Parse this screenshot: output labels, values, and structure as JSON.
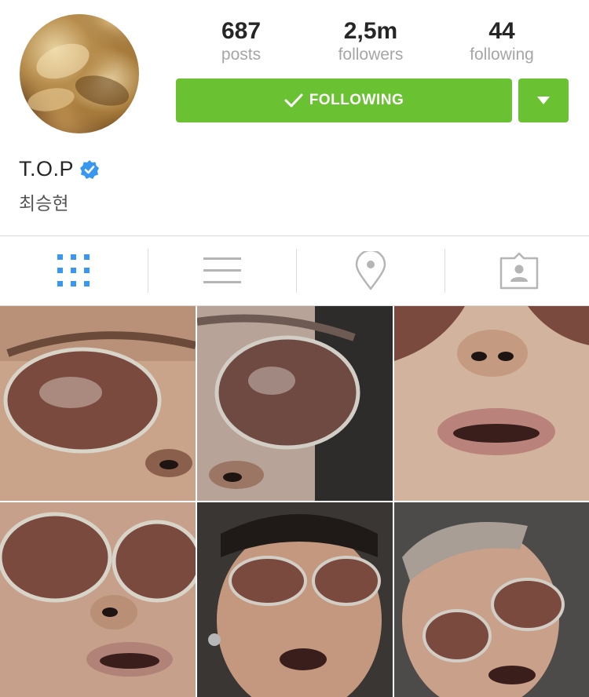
{
  "profile": {
    "username": "T.O.P",
    "full_name": "최승현",
    "verified": true
  },
  "stats": {
    "posts": {
      "value": "687",
      "label": "posts"
    },
    "followers": {
      "value": "2,5m",
      "label": "followers"
    },
    "following": {
      "value": "44",
      "label": "following"
    }
  },
  "actions": {
    "follow_label": "FOLLOWING",
    "follow_icon": "checkmark-icon",
    "dropdown_icon": "caret-down-icon"
  },
  "tabs": [
    {
      "icon": "grid-view-icon",
      "active": true
    },
    {
      "icon": "list-view-icon",
      "active": false
    },
    {
      "icon": "location-pin-icon",
      "active": false
    },
    {
      "icon": "tagged-photos-icon",
      "active": false
    }
  ],
  "colors": {
    "accent_green": "#6ac131",
    "active_tab_blue": "#3897f0",
    "verified_blue": "#3897f0",
    "inactive_icon": "#b5b5b5"
  },
  "photos": [
    {
      "subject": "selfie with aviator sunglasses"
    },
    {
      "subject": "selfie with aviator sunglasses"
    },
    {
      "subject": "close-up of mouth"
    },
    {
      "subject": "selfie with aviator sunglasses"
    },
    {
      "subject": "selfie with aviator sunglasses"
    },
    {
      "subject": "selfie with aviator sunglasses"
    }
  ]
}
